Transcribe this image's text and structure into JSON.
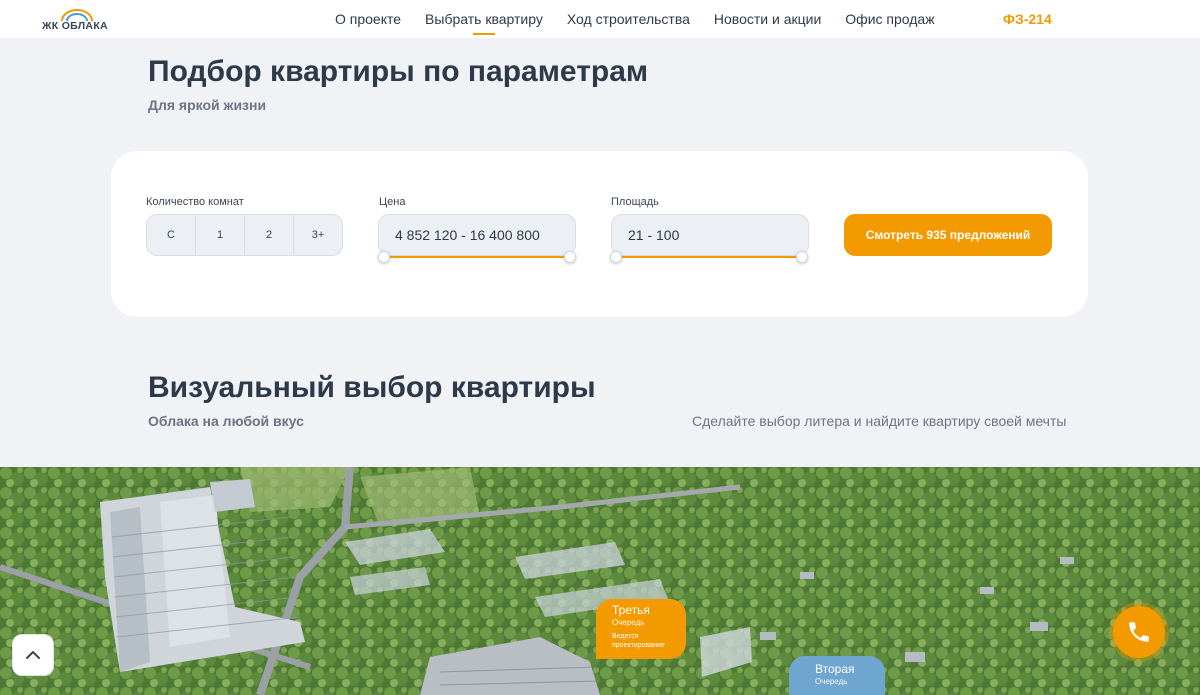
{
  "header": {
    "logo_text": "ЖК ОБЛАКА",
    "nav": [
      {
        "label": "О проекте"
      },
      {
        "label": "Выбрать квартиру",
        "active": true
      },
      {
        "label": "Ход строительства"
      },
      {
        "label": "Новости и акции"
      },
      {
        "label": "Офис продаж"
      }
    ],
    "fz_link": "ФЗ-214"
  },
  "filter_section": {
    "title": "Подбор квартиры по параметрам",
    "subtitle": "Для яркой жизни",
    "rooms_label": "Количество комнат",
    "rooms_options": [
      "С",
      "1",
      "2",
      "3+"
    ],
    "price_label": "Цена",
    "price_value": "4 852 120 - 16 400 800",
    "area_label": "Площадь",
    "area_value": "21 - 100",
    "submit_label": "Смотреть 935 предложений"
  },
  "visual_section": {
    "title": "Визуальный выбор квартиры",
    "subtitle": "Облака на любой вкус",
    "hint": "Сделайте выбор литера и найдите квартиру своей мечты",
    "phases": [
      {
        "title": "Третья",
        "subtitle": "Очередь",
        "note_line1": "Ведется",
        "note_line2": "проектирование"
      },
      {
        "title": "Вторая",
        "subtitle": "Очередь"
      }
    ]
  },
  "icons": {
    "scroll_top": "chevron-up-icon",
    "call": "phone-icon"
  },
  "colors": {
    "accent": "#f29a00",
    "text": "#2e3a4a",
    "muted": "#6a7585",
    "background": "#f0f2f6",
    "phase_two": "#6fa6cf"
  }
}
